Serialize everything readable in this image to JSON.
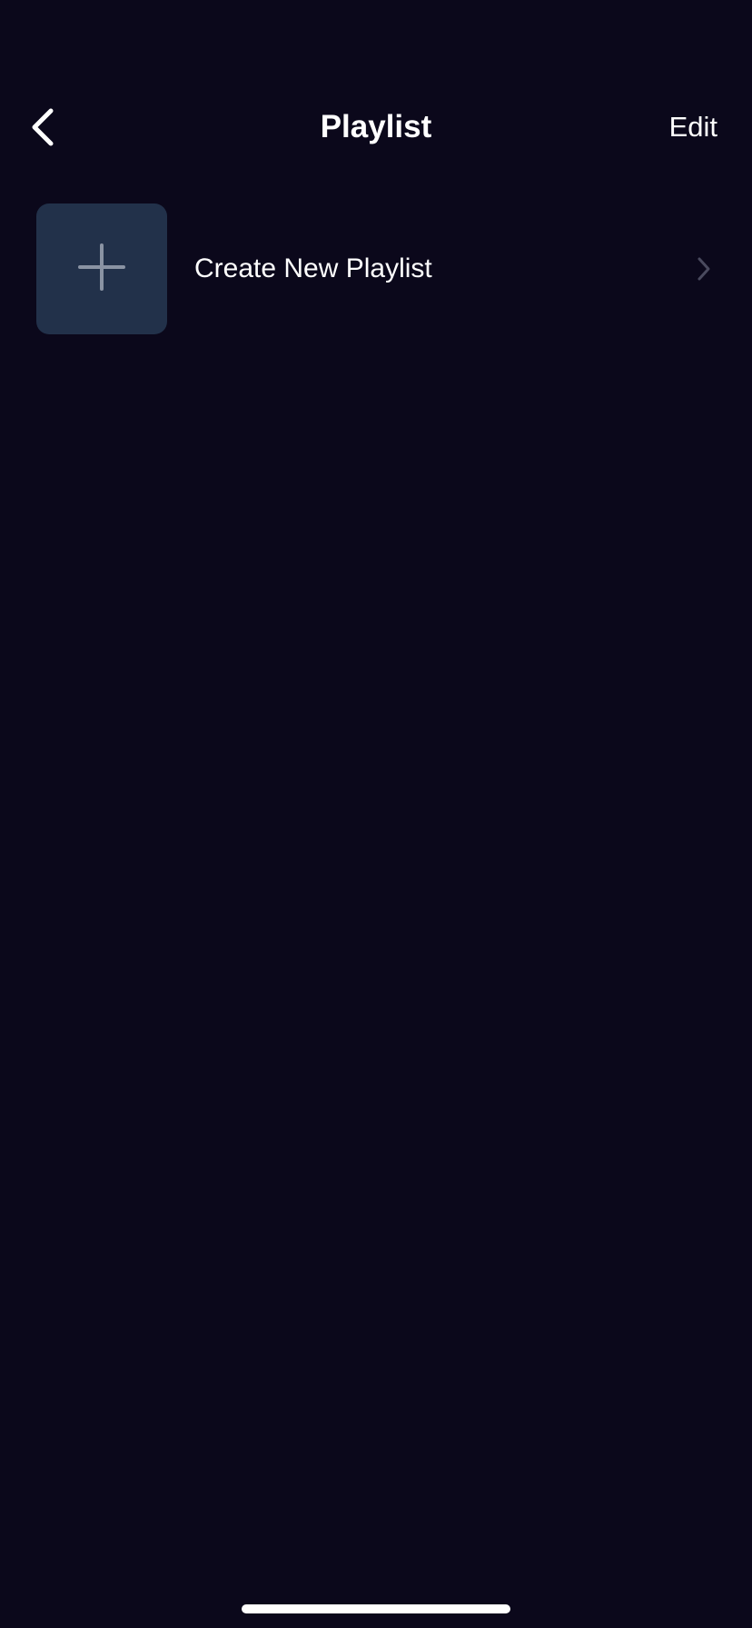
{
  "nav": {
    "title": "Playlist",
    "edit_label": "Edit",
    "back_icon": "chevron-left-icon"
  },
  "playlists": {
    "create_item": {
      "label": "Create New Playlist",
      "icon": "plus-icon",
      "chevron_icon": "chevron-right-icon"
    }
  },
  "colors": {
    "background": "#0b081b",
    "thumbnail": "#22314a",
    "plus": "#8a93a3",
    "chevron": "#4a4a5e",
    "text": "#ffffff"
  }
}
